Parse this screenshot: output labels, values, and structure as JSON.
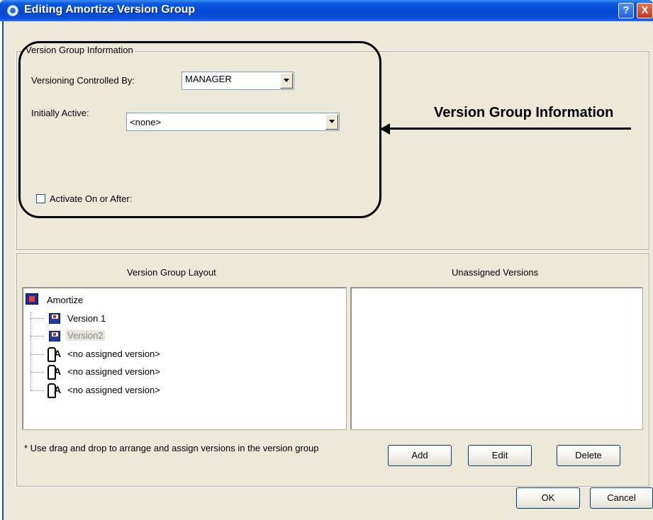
{
  "window": {
    "title": "Editing Amortize Version Group",
    "help_label": "?",
    "close_label": "X"
  },
  "info_group": {
    "legend": "Version Group Information",
    "versioning_label": "Versioning Controlled By:",
    "versioning_value": "MANAGER",
    "initially_active_label": "Initially Active:",
    "initially_active_value": "<none>",
    "activate_label": "Activate On or After:",
    "activate_checked": false
  },
  "annotation": {
    "text": "Version Group Information"
  },
  "layout_panel": {
    "title": "Version Group Layout",
    "root": "Amortize",
    "items": [
      {
        "label": "Version 1",
        "icon": "version-disk-icon",
        "dimmed": false
      },
      {
        "label": "Version2",
        "icon": "version-disk-icon",
        "dimmed": true
      },
      {
        "label": "<no assigned version>",
        "icon": "empty-slot-icon",
        "dimmed": false
      },
      {
        "label": "<no assigned version>",
        "icon": "empty-slot-icon",
        "dimmed": false
      },
      {
        "label": "<no assigned version>",
        "icon": "empty-slot-icon",
        "dimmed": false
      }
    ]
  },
  "unassigned_panel": {
    "title": "Unassigned Versions"
  },
  "hint": "* Use drag and drop to arrange and assign versions in the version group",
  "buttons": {
    "add": "Add",
    "edit": "Edit",
    "delete": "Delete",
    "ok": "OK",
    "cancel": "Cancel"
  }
}
